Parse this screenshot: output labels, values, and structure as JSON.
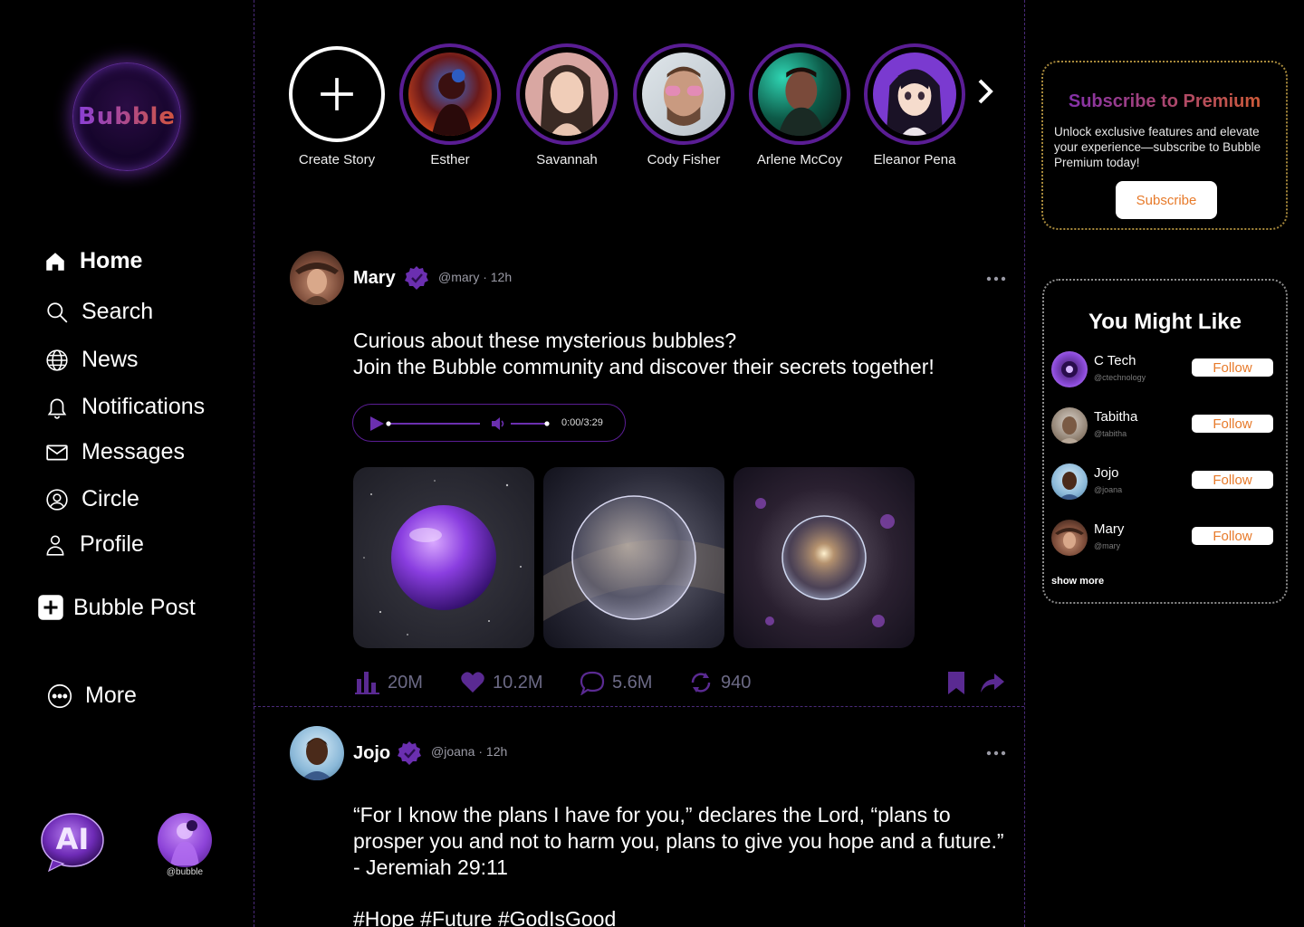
{
  "brand": {
    "logo_text": "Bubble"
  },
  "nav": [
    {
      "label": "Home",
      "icon": "home-icon",
      "active": true
    },
    {
      "label": "Search",
      "icon": "search-icon"
    },
    {
      "label": "News",
      "icon": "globe-icon"
    },
    {
      "label": "Notifications",
      "icon": "bell-icon"
    },
    {
      "label": "Messages",
      "icon": "mail-icon"
    },
    {
      "label": "Circle",
      "icon": "user-circle-icon"
    },
    {
      "label": "Profile",
      "icon": "user-icon"
    }
  ],
  "bubble_post_label": "Bubble Post",
  "more_label": "More",
  "ai_label": "AI",
  "me": {
    "handle": "@bubble"
  },
  "stories": {
    "create_label": "Create Story",
    "items": [
      {
        "name": "Esther"
      },
      {
        "name": "Savannah"
      },
      {
        "name": "Cody Fisher"
      },
      {
        "name": "Arlene McCoy"
      },
      {
        "name": "Eleanor Pena"
      }
    ],
    "next_icon": "chevron-right-icon"
  },
  "posts": [
    {
      "name": "Mary",
      "handle": "@mary",
      "time": "12h",
      "meta": "@mary · 12h",
      "text_line1": "Curious about these mysterious bubbles?",
      "text_line2": "Join the Bubble community and discover their secrets together!",
      "audio_time": "0:00/3:29",
      "stats": {
        "views": "20M",
        "likes": "10.2M",
        "comments": "5.6M",
        "reposts": "940"
      }
    },
    {
      "name": "Jojo",
      "handle": "@joana",
      "time": "12h",
      "meta": "@joana · 12h",
      "text": "“For I know the plans I have for you,” declares the Lord, “plans to prosper you and not to harm you, plans to give you hope and a future.” - Jeremiah 29:11",
      "hashtags": "#Hope #Future #GodIsGood"
    }
  ],
  "premium": {
    "title": "Subscribe to Premium",
    "body": "Unlock exclusive features and elevate your experience—subscribe to Bubble Premium today!",
    "button": "Subscribe"
  },
  "suggestions": {
    "title": "You Might Like",
    "follow_label": "Follow",
    "items": [
      {
        "name": "C Tech",
        "handle": "@ctechnology"
      },
      {
        "name": "Tabitha",
        "handle": "@tabitha"
      },
      {
        "name": "Jojo",
        "handle": "@joana"
      },
      {
        "name": "Mary",
        "handle": "@mary"
      }
    ],
    "show_more": "show more"
  },
  "colors": {
    "accent_purple": "#6b2fb0",
    "accent_orange": "#e77a2a",
    "divider": "#4a2a7a"
  }
}
